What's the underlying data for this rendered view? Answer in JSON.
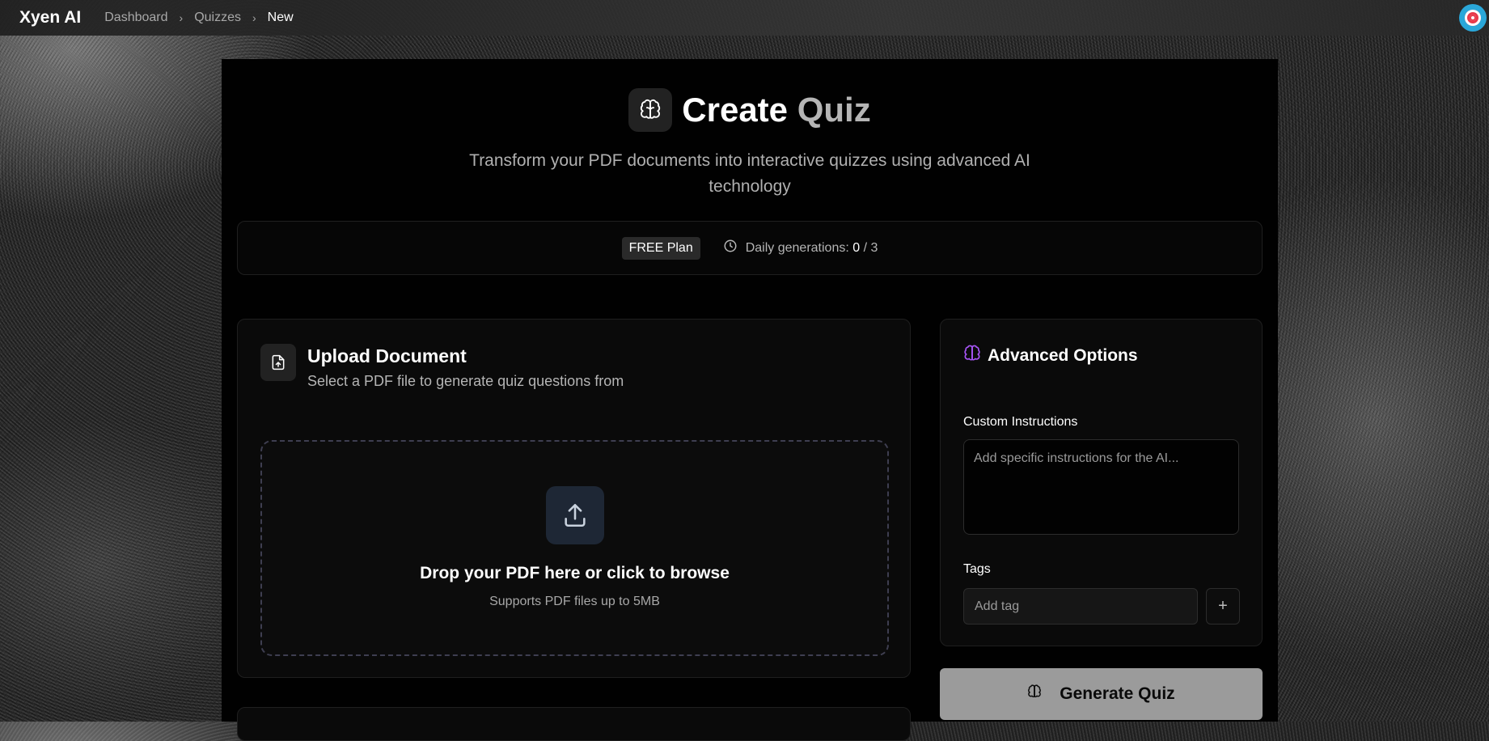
{
  "nav": {
    "brand": "Xyen AI",
    "breadcrumbs": [
      "Dashboard",
      "Quizzes",
      "New"
    ],
    "separator": "›"
  },
  "header": {
    "title_part1": "Create",
    "title_part2": "Quiz",
    "subtitle": "Transform your PDF documents into interactive quizzes using advanced AI technology"
  },
  "plan": {
    "badge": "FREE Plan",
    "daily_label": "Daily generations:",
    "used": "0",
    "limit": "/ 3"
  },
  "upload": {
    "title": "Upload Document",
    "subtitle": "Select a PDF file to generate quiz questions from",
    "drop_title": "Drop your PDF here or click to browse",
    "drop_sub": "Supports PDF files up to 5MB"
  },
  "advanced": {
    "title": "Advanced Options",
    "custom_label": "Custom Instructions",
    "custom_placeholder": "Add specific instructions for the AI...",
    "tags_label": "Tags",
    "tag_placeholder": "Add tag",
    "add_symbol": "+"
  },
  "actions": {
    "generate": "Generate Quiz"
  },
  "colors": {
    "accent_purple": "#a855f7",
    "generate_bg": "#9b9b9b",
    "avatar_blue": "#2aa7d9",
    "avatar_red": "#e8394a"
  },
  "icons": [
    "brain-icon",
    "clock-icon",
    "file-upload-icon",
    "upload-icon",
    "plus-icon",
    "target-avatar-icon"
  ]
}
